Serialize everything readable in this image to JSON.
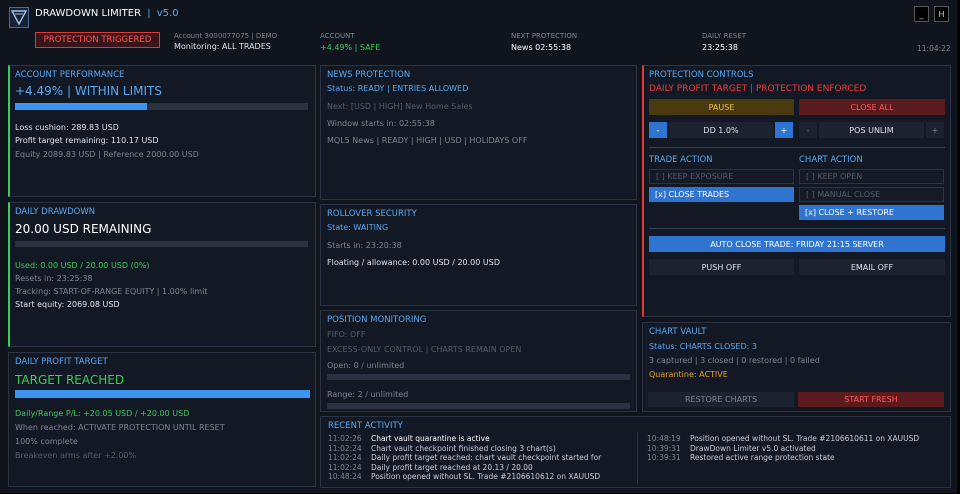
{
  "header": {
    "title": "DRAWDOWN LIMITER",
    "version": "v5.0",
    "separator": "|",
    "badge": "PROTECTION TRIGGERED",
    "account_line": "Account 3000077075  |  DEMO",
    "monitoring": "Monitoring: ALL TRADES",
    "account_label": "ACCOUNT",
    "account_value": "+4.49% | SAFE",
    "next_label": "NEXT PROTECTION",
    "next_value": "News 02:55:38",
    "reset_label": "DAILY RESET",
    "reset_value": "23:25:38",
    "clock": "11:04:22",
    "min_btn": "_",
    "hide_btn": "H"
  },
  "account_performance": {
    "title": "ACCOUNT PERFORMANCE",
    "headline": "+4.49% | WITHIN LIMITS",
    "progress": 0.45,
    "loss_cushion": "Loss cushion: 289.83 USD",
    "profit_remaining": "Profit target remaining: 110.17 USD",
    "equity_line": "Equity 2089.83 USD | Reference 2000.00 USD"
  },
  "daily_drawdown": {
    "title": "DAILY DRAWDOWN",
    "headline": "20.00 USD REMAINING",
    "progress": 0,
    "used": "Used: 0.00 USD / 20.00 USD (0%)",
    "resets": "Resets in: 23:25:38",
    "tracking": "Tracking: START-OF-RANGE EQUITY | 1.00% limit",
    "start_equity": "Start equity: 2069.08 USD"
  },
  "daily_profit": {
    "title": "DAILY PROFIT TARGET",
    "headline": "TARGET REACHED",
    "progress": 1.0,
    "pl": "Daily/Range P/L: +20.05 USD / +20.00 USD",
    "when": "When reached: ACTIVATE PROTECTION UNTIL RESET",
    "complete": "100% complete",
    "breakeven": "Breakeven arms after +2.00%"
  },
  "news": {
    "title": "NEWS PROTECTION",
    "status": "Status: READY | ENTRIES ALLOWED",
    "next": "Next: [USD | HIGH] New Home Sales",
    "window": "Window starts in: 02:55:38",
    "source": "MQL5 News | READY | HIGH | USD | HOLIDAYS OFF"
  },
  "rollover": {
    "title": "ROLLOVER SECURITY",
    "state": "State: WAITING",
    "starts": "Starts in: 23:20:38",
    "floating": "Floating / allowance: 0.00 USD / 20.00 USD"
  },
  "position_monitoring": {
    "title": "POSITION MONITORING",
    "fifo": "FIFO: OFF",
    "excess": "EXCESS-ONLY CONTROL | CHARTS REMAIN OPEN",
    "open": "Open: 0 / unlimited",
    "open_progress": 0,
    "range": "Range: 2 / unlimited",
    "range_progress": 0
  },
  "controls": {
    "title": "PROTECTION CONTROLS",
    "status": "DAILY PROFIT TARGET | PROTECTION ENFORCED",
    "pause": "PAUSE",
    "close_all": "CLOSE ALL",
    "minus": "-",
    "plus": "+",
    "dd_value": "DD 1.0%",
    "pos_value": "POS UNLIM",
    "trade_action_title": "TRADE ACTION",
    "keep_exposure": "[ ] KEEP EXPOSURE",
    "close_trades": "[x] CLOSE TRADES",
    "chart_action_title": "CHART ACTION",
    "keep_open": "[ ] KEEP OPEN",
    "manual_close": "[ ] MANUAL CLOSE",
    "close_restore": "[x] CLOSE + RESTORE",
    "auto_close": "AUTO CLOSE TRADE: FRIDAY 21:15 SERVER",
    "push": "PUSH OFF",
    "email": "EMAIL OFF"
  },
  "chart_vault": {
    "title": "CHART VAULT",
    "status": "Status: CHARTS CLOSED: 3",
    "counts": "3 captured | 3 closed | 0 restored | 0 failed",
    "quarantine": "Quarantine: ACTIVE",
    "restore": "RESTORE CHARTS",
    "fresh": "START FRESH"
  },
  "activity": {
    "title": "RECENT ACTIVITY",
    "left": [
      {
        "time": "11:02:26",
        "msg": "Chart vault quarantine is active"
      },
      {
        "time": "11:02:24",
        "msg": "Chart vault checkpoint finished  closing 3 chart(s)"
      },
      {
        "time": "11:02:24",
        "msg": "Daily profit target reached: chart vault checkpoint started for"
      },
      {
        "time": "11:02:24",
        "msg": "Daily profit target reached at 20.13 / 20.00"
      },
      {
        "time": "10:48:24",
        "msg": "Position opened without SL. Trade #2106610612 on XAUUSD"
      }
    ],
    "right": [
      {
        "time": "10:48:19",
        "msg": "Position opened without SL. Trade #2106610611 on XAUUSD"
      },
      {
        "time": "10:39:31",
        "msg": "DrawDown Limiter v5.0 activated"
      },
      {
        "time": "10:39:31",
        "msg": "Restored active range protection state"
      }
    ]
  },
  "colors": {
    "accent": "#5aa8f0",
    "safe": "#3ccc5a",
    "danger": "#f03c3c",
    "warning": "#e8a020",
    "progress": "#3a94f0"
  }
}
